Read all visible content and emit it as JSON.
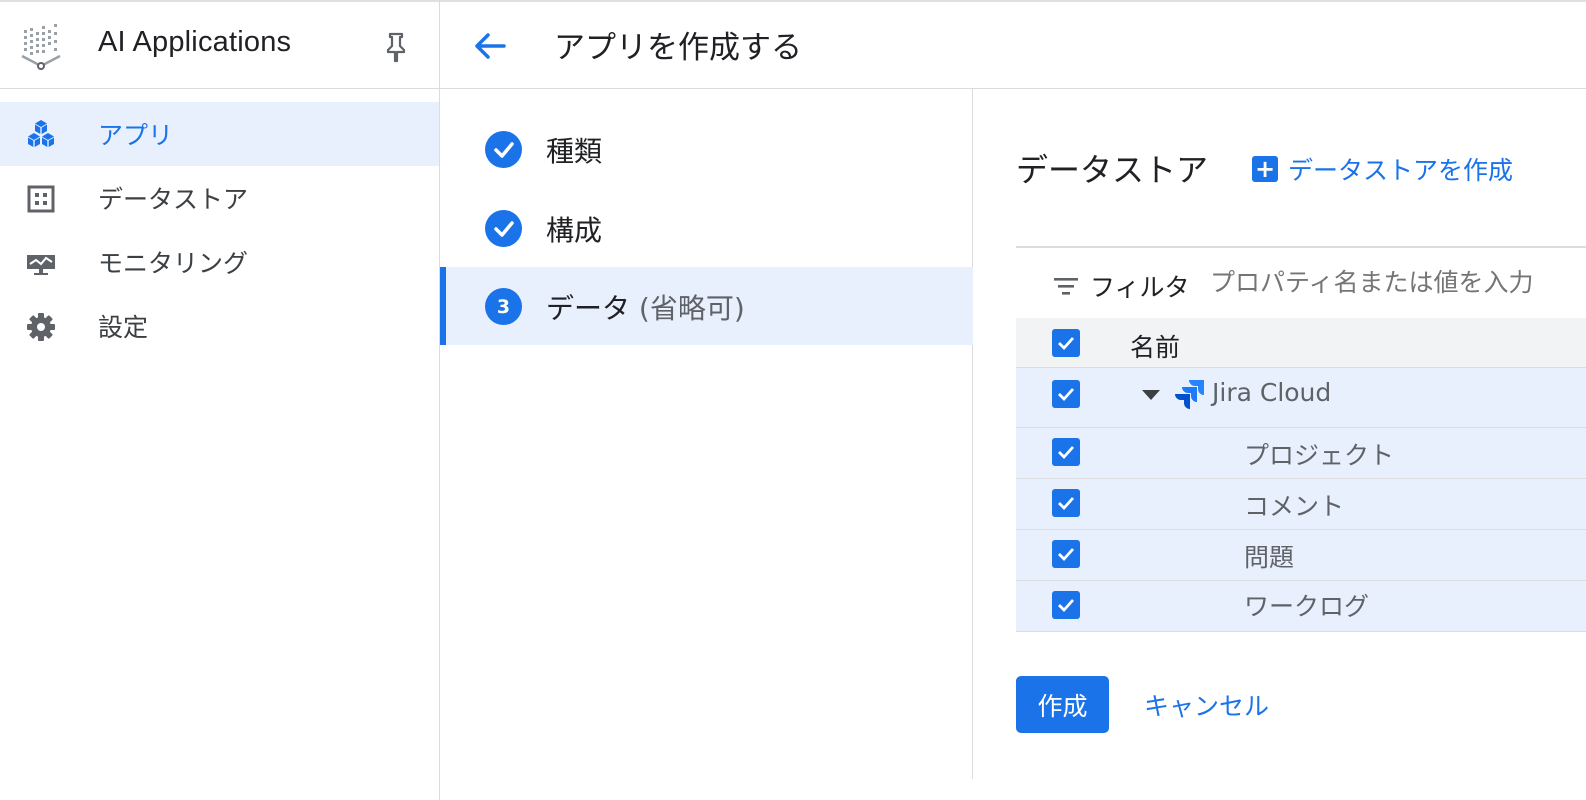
{
  "sidebar": {
    "app_title": "AI Applications",
    "items": [
      {
        "label": "アプリ",
        "icon": "cubes-icon",
        "active": true
      },
      {
        "label": "データストア",
        "icon": "grid-icon",
        "active": false
      },
      {
        "label": "モニタリング",
        "icon": "monitoring-icon",
        "active": false
      },
      {
        "label": "設定",
        "icon": "gear-icon",
        "active": false
      }
    ]
  },
  "header": {
    "title": "アプリを作成する"
  },
  "stepper": {
    "steps": [
      {
        "label": "種類",
        "state": "done"
      },
      {
        "label": "構成",
        "state": "done"
      },
      {
        "label": "データ",
        "optional": "(省略可)",
        "number": "3",
        "state": "active"
      }
    ]
  },
  "datastore": {
    "title": "データストア",
    "create_label": "データストアを作成",
    "filter_label": "フィルタ",
    "filter_placeholder": "プロパティ名または値を入力",
    "column_name": "名前",
    "rows": [
      {
        "label": "Jira Cloud",
        "checked": true,
        "expanded": true
      },
      {
        "label": "プロジェクト",
        "checked": true
      },
      {
        "label": "コメント",
        "checked": true
      },
      {
        "label": "問題",
        "checked": true
      },
      {
        "label": "ワークログ",
        "checked": true
      }
    ]
  },
  "actions": {
    "create_label": "作成",
    "cancel_label": "キャンセル"
  },
  "colors": {
    "accent": "#1a73e8",
    "active_bg": "#e8f0fe",
    "header_row_bg": "#f1f3f4"
  }
}
